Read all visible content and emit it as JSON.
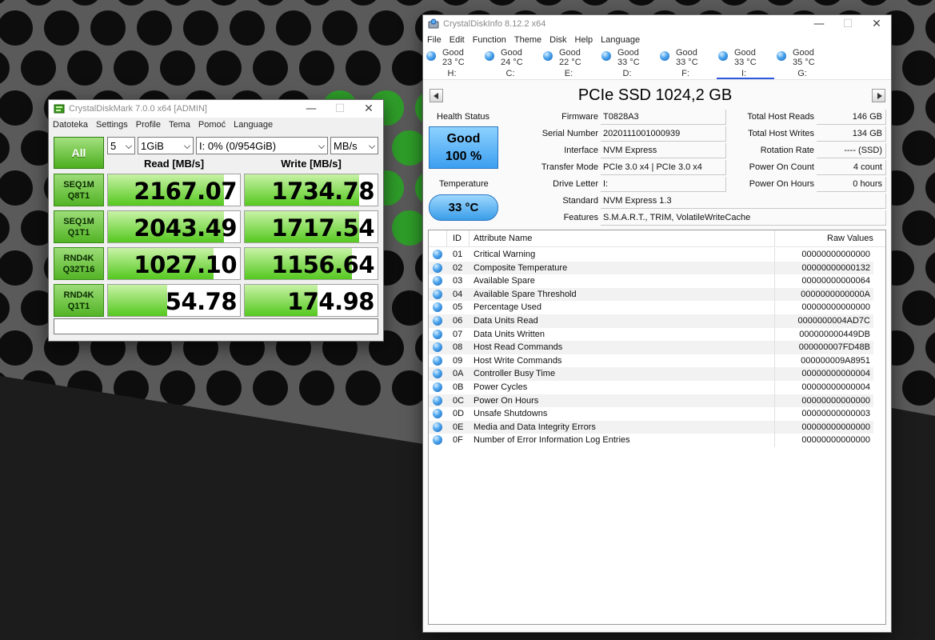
{
  "cdm": {
    "title": "CrystalDiskMark 7.0.0 x64 [ADMIN]",
    "menu": [
      "Datoteka",
      "Settings",
      "Profile",
      "Tema",
      "Pomoć",
      "Language"
    ],
    "all_label": "All",
    "count": "5",
    "size": "1GiB",
    "drive": "I: 0% (0/954GiB)",
    "unit": "MB/s",
    "read_header": "Read [MB/s]",
    "write_header": "Write [MB/s]",
    "rows": [
      {
        "l1": "SEQ1M",
        "l2": "Q8T1",
        "read": "2167.07",
        "write": "1734.78",
        "read_level": 0.88,
        "write_level": 0.86
      },
      {
        "l1": "SEQ1M",
        "l2": "Q1T1",
        "read": "2043.49",
        "write": "1717.54",
        "read_level": 0.88,
        "write_level": 0.86
      },
      {
        "l1": "RND4K",
        "l2": "Q32T16",
        "read": "1027.10",
        "write": "1156.64",
        "read_level": 0.8,
        "write_level": 0.81
      },
      {
        "l1": "RND4K",
        "l2": "Q1T1",
        "read": "54.78",
        "write": "174.98",
        "read_level": 0.45,
        "write_level": 0.55
      }
    ],
    "comment": ""
  },
  "cdi": {
    "title": "CrystalDiskInfo 8.12.2 x64",
    "menu": [
      "File",
      "Edit",
      "Function",
      "Theme",
      "Disk",
      "Help",
      "Language"
    ],
    "drives": [
      {
        "status": "Good",
        "temp": "23 °C",
        "letter": "H:"
      },
      {
        "status": "Good",
        "temp": "24 °C",
        "letter": "C:"
      },
      {
        "status": "Good",
        "temp": "22 °C",
        "letter": "E:"
      },
      {
        "status": "Good",
        "temp": "33 °C",
        "letter": "D:"
      },
      {
        "status": "Good",
        "temp": "33 °C",
        "letter": "F:"
      },
      {
        "status": "Good",
        "temp": "33 °C",
        "letter": "I:"
      },
      {
        "status": "Good",
        "temp": "35 °C",
        "letter": "G:"
      }
    ],
    "active_drive_index": 5,
    "disk_title": "PCIe SSD 1024,2 GB",
    "health_label": "Health Status",
    "health_status": "Good",
    "health_percent": "100 %",
    "temperature_label": "Temperature",
    "temperature": "33 °C",
    "info_left": [
      {
        "label": "Firmware",
        "value": "T0828A3"
      },
      {
        "label": "Serial Number",
        "value": "2020111001000939"
      },
      {
        "label": "Interface",
        "value": "NVM Express"
      },
      {
        "label": "Transfer Mode",
        "value": "PCIe 3.0 x4 | PCIe 3.0 x4"
      },
      {
        "label": "Drive Letter",
        "value": "I:"
      }
    ],
    "standard": {
      "label": "Standard",
      "value": "NVM Express 1.3"
    },
    "features": {
      "label": "Features",
      "value": "S.M.A.R.T., TRIM, VolatileWriteCache"
    },
    "info_right": [
      {
        "label": "Total Host Reads",
        "value": "146 GB"
      },
      {
        "label": "Total Host Writes",
        "value": "134 GB"
      },
      {
        "label": "Rotation Rate",
        "value": "---- (SSD)"
      },
      {
        "label": "Power On Count",
        "value": "4 count"
      },
      {
        "label": "Power On Hours",
        "value": "0 hours"
      }
    ],
    "attr_headers": {
      "id": "ID",
      "name": "Attribute Name",
      "raw": "Raw Values"
    },
    "attributes": [
      {
        "id": "01",
        "name": "Critical Warning",
        "raw": "00000000000000"
      },
      {
        "id": "02",
        "name": "Composite Temperature",
        "raw": "00000000000132"
      },
      {
        "id": "03",
        "name": "Available Spare",
        "raw": "00000000000064"
      },
      {
        "id": "04",
        "name": "Available Spare Threshold",
        "raw": "0000000000000A"
      },
      {
        "id": "05",
        "name": "Percentage Used",
        "raw": "00000000000000"
      },
      {
        "id": "06",
        "name": "Data Units Read",
        "raw": "0000000004AD7C"
      },
      {
        "id": "07",
        "name": "Data Units Written",
        "raw": "000000000449DB"
      },
      {
        "id": "08",
        "name": "Host Read Commands",
        "raw": "000000007FD48B"
      },
      {
        "id": "09",
        "name": "Host Write Commands",
        "raw": "000000009A8951"
      },
      {
        "id": "0A",
        "name": "Controller Busy Time",
        "raw": "00000000000004"
      },
      {
        "id": "0B",
        "name": "Power Cycles",
        "raw": "00000000000004"
      },
      {
        "id": "0C",
        "name": "Power On Hours",
        "raw": "00000000000000"
      },
      {
        "id": "0D",
        "name": "Unsafe Shutdowns",
        "raw": "00000000000003"
      },
      {
        "id": "0E",
        "name": "Media and Data Integrity Errors",
        "raw": "00000000000000"
      },
      {
        "id": "0F",
        "name": "Number of Error Information Log Entries",
        "raw": "00000000000000"
      }
    ]
  }
}
